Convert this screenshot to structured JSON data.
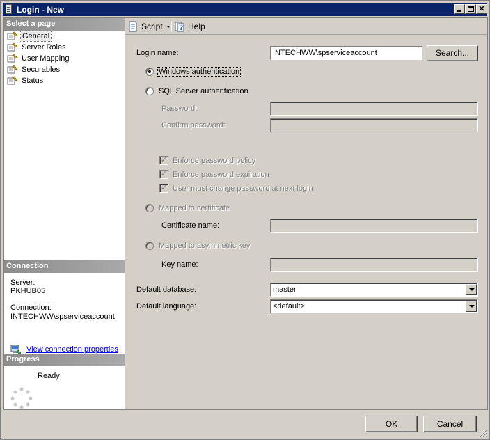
{
  "window": {
    "title": "Login - New",
    "icon": "document-icon"
  },
  "left": {
    "select_page_header": "Select a page",
    "pages": [
      {
        "label": "General",
        "icon": "page-wrench-icon",
        "selected": true
      },
      {
        "label": "Server Roles",
        "icon": "page-wrench-icon"
      },
      {
        "label": "User Mapping",
        "icon": "page-wrench-icon"
      },
      {
        "label": "Securables",
        "icon": "page-wrench-icon"
      },
      {
        "label": "Status",
        "icon": "page-wrench-icon"
      }
    ],
    "connection_header": "Connection",
    "server_label": "Server:",
    "server_value": "PKHUB05",
    "connection_label": "Connection:",
    "connection_value": "INTECHWW\\spserviceaccount",
    "view_link": "View connection properties",
    "progress_header": "Progress",
    "progress_status": "Ready"
  },
  "toolbar": {
    "script_label": "Script",
    "help_label": "Help"
  },
  "form": {
    "login_name_label": "Login name:",
    "login_name_value": "INTECHWW\\spserviceaccount",
    "search_button": "Search...",
    "windows_auth": "Windows authentication",
    "sql_auth": "SQL Server authentication",
    "password_label": "Password:",
    "confirm_password_label": "Confirm password:",
    "enforce_policy": "Enforce password policy",
    "enforce_expiration": "Enforce password expiration",
    "must_change": "User must change password at next login",
    "mapped_cert": "Mapped to certificate",
    "cert_name_label": "Certificate name:",
    "mapped_asym": "Mapped to asymmetric key",
    "key_name_label": "Key name:",
    "default_db_label": "Default database:",
    "default_db_value": "master",
    "default_lang_label": "Default language:",
    "default_lang_value": "<default>"
  },
  "buttons": {
    "ok": "OK",
    "cancel": "Cancel"
  },
  "colors": {
    "titlebar": "#0a246a",
    "face": "#d4d0c8",
    "link": "#0000ee"
  }
}
